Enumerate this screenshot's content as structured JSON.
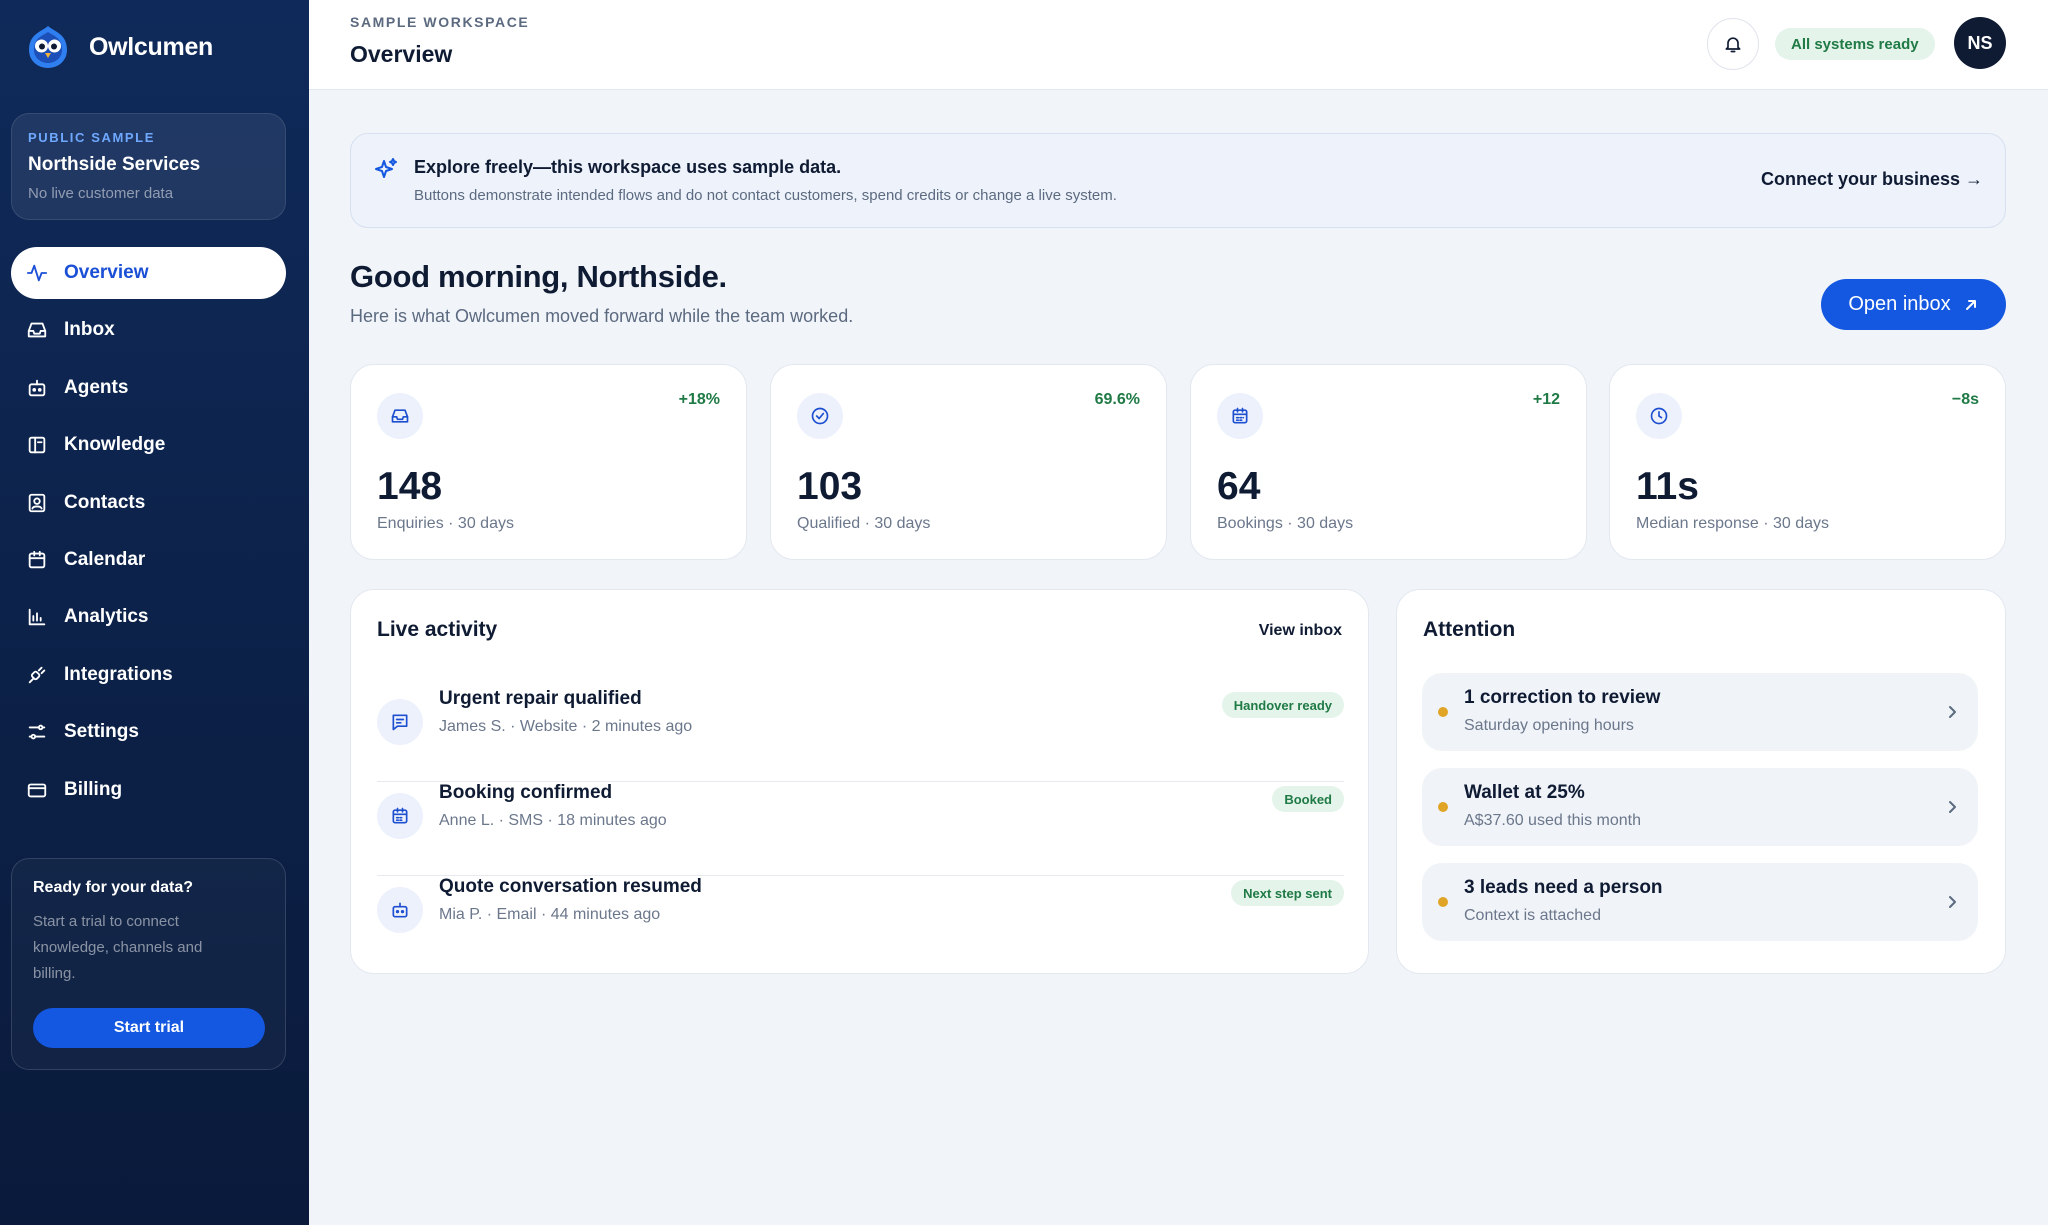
{
  "app": {
    "name": "Owlcumen"
  },
  "workspace": {
    "tag": "PUBLIC SAMPLE",
    "name": "Northside Services",
    "note": "No live customer data"
  },
  "nav": [
    {
      "label": "Overview",
      "icon": "pulse-icon",
      "active": true
    },
    {
      "label": "Inbox",
      "icon": "inbox-icon"
    },
    {
      "label": "Agents",
      "icon": "robot-icon"
    },
    {
      "label": "Knowledge",
      "icon": "book-icon"
    },
    {
      "label": "Contacts",
      "icon": "contact-card-icon"
    },
    {
      "label": "Calendar",
      "icon": "calendar-icon"
    },
    {
      "label": "Analytics",
      "icon": "bar-chart-icon"
    },
    {
      "label": "Integrations",
      "icon": "plug-icon"
    },
    {
      "label": "Settings",
      "icon": "sliders-icon"
    },
    {
      "label": "Billing",
      "icon": "credit-card-icon"
    }
  ],
  "trial": {
    "title": "Ready for your data?",
    "text": "Start a trial to connect knowledge, channels and billing.",
    "button": "Start trial"
  },
  "header": {
    "breadcrumb": "SAMPLE WORKSPACE",
    "title": "Overview",
    "status": "All systems ready",
    "avatar_initials": "NS"
  },
  "banner": {
    "title": "Explore freely—this workspace uses sample data.",
    "subtitle": "Buttons demonstrate intended flows and do not contact customers, spend credits or change a live system.",
    "link": "Connect your business →"
  },
  "greeting": {
    "title": "Good morning, Northside.",
    "subtitle": "Here is what Owlcumen moved forward while the team worked.",
    "button": "Open inbox"
  },
  "stats": [
    {
      "value": "148",
      "label": "Enquiries · 30 days",
      "delta": "+18%",
      "icon": "inbox-icon"
    },
    {
      "value": "103",
      "label": "Qualified · 30 days",
      "delta": "69.6%",
      "icon": "check-circle-icon"
    },
    {
      "value": "64",
      "label": "Bookings · 30 days",
      "delta": "+12",
      "icon": "calendar-icon"
    },
    {
      "value": "11s",
      "label": "Median response · 30 days",
      "delta": "−8s",
      "icon": "clock-icon"
    }
  ],
  "live_activity": {
    "title": "Live activity",
    "link": "View inbox",
    "items": [
      {
        "title": "Urgent repair qualified",
        "meta": "James S. · Website · 2 minutes ago",
        "badge": "Handover ready",
        "icon": "message-icon"
      },
      {
        "title": "Booking confirmed",
        "meta": "Anne L. · SMS · 18 minutes ago",
        "badge": "Booked",
        "icon": "calendar-icon"
      },
      {
        "title": "Quote conversation resumed",
        "meta": "Mia P. · Email · 44 minutes ago",
        "badge": "Next step sent",
        "icon": "robot-icon"
      }
    ]
  },
  "attention": {
    "title": "Attention",
    "items": [
      {
        "title": "1 correction to review",
        "subtitle": "Saturday opening hours"
      },
      {
        "title": "Wallet at 25%",
        "subtitle": "A$37.60 used this month"
      },
      {
        "title": "3 leads need a person",
        "subtitle": "Context is attached"
      }
    ]
  },
  "colors": {
    "sidebar": "#0f2a5a",
    "accent": "#1457e0",
    "success": "#1f7a45",
    "warning": "#e0a526"
  }
}
